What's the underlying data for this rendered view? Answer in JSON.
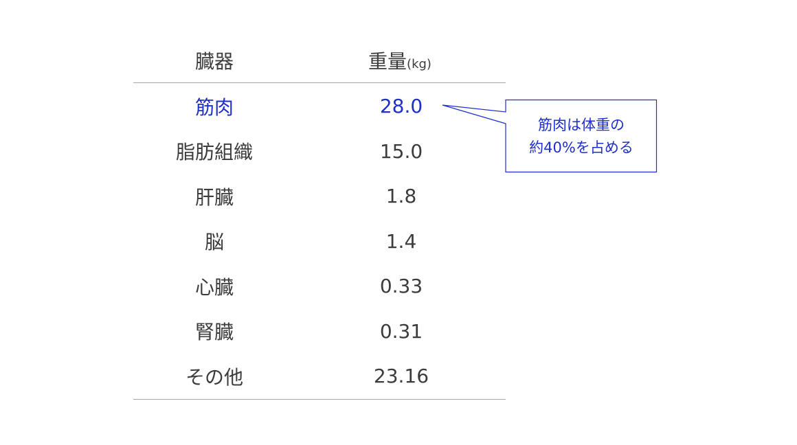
{
  "table": {
    "header": {
      "organ": "臓器",
      "weight": "重量",
      "unit": "(kg)"
    },
    "rows": [
      {
        "organ": "筋肉",
        "weight": "28.0"
      },
      {
        "organ": "脂肪組織",
        "weight": "15.0"
      },
      {
        "organ": "肝臓",
        "weight": "1.8"
      },
      {
        "organ": "脳",
        "weight": "1.4"
      },
      {
        "organ": "心臓",
        "weight": "0.33"
      },
      {
        "organ": "腎臓",
        "weight": "0.31"
      },
      {
        "organ": "その他",
        "weight": "23.16"
      }
    ]
  },
  "callout": {
    "line1": "筋肉は体重の",
    "line2": "約40%を占める"
  },
  "colors": {
    "highlight": "#1f2fc7",
    "text": "#3c3c3c",
    "rule": "#a6a6a6"
  }
}
